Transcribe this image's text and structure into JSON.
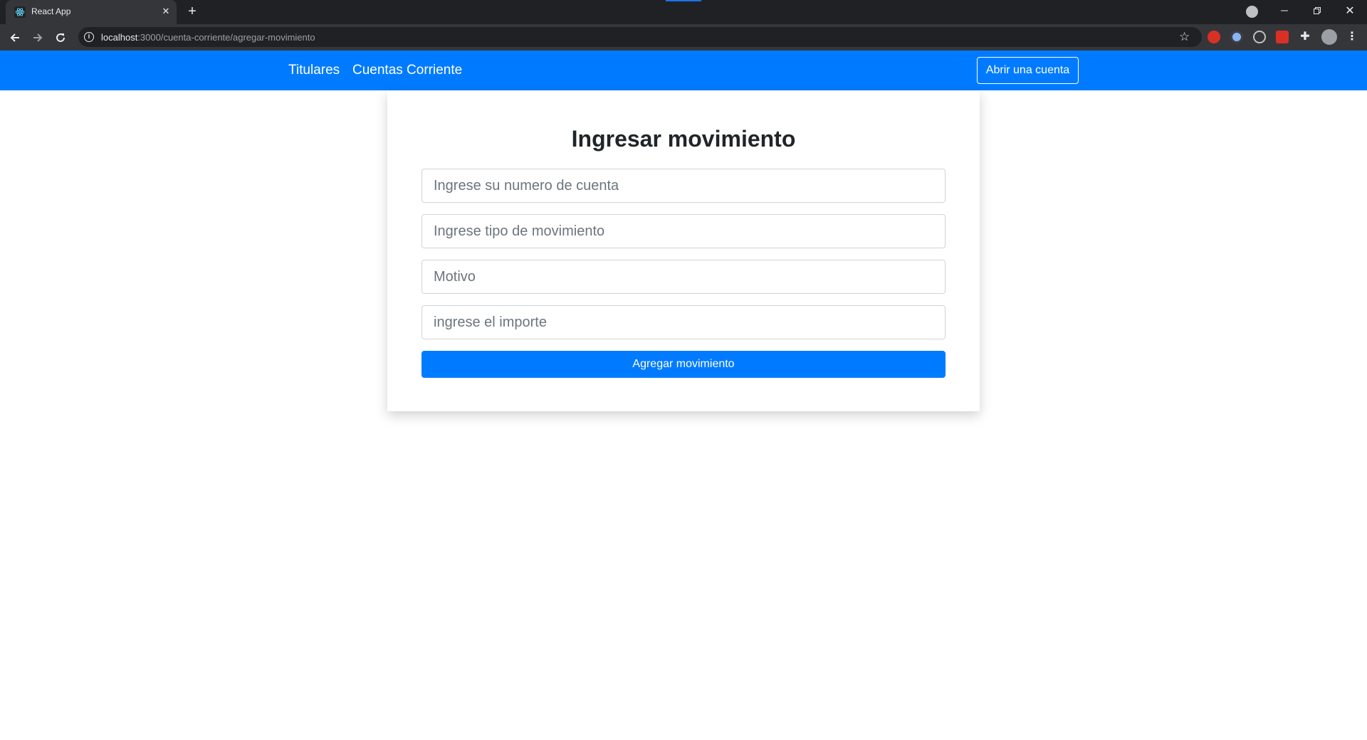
{
  "browser": {
    "tab_title": "React App",
    "url_host": "localhost",
    "url_path": ":3000/cuenta-corriente/agregar-movimiento",
    "icons": [
      "react-favicon",
      "tab-close-icon",
      "new-tab-icon",
      "back-arrow-icon",
      "forward-arrow-icon",
      "reload-icon",
      "site-info-icon",
      "bookmark-star-icon",
      "extensions-puzzle-icon",
      "profile-avatar-icon",
      "more-menu-icon"
    ]
  },
  "navbar": {
    "links": [
      "Titulares",
      "Cuentas Corriente"
    ],
    "action_label": "Abrir una cuenta",
    "color": "#007bff"
  },
  "form": {
    "title": "Ingresar movimiento",
    "fields": [
      {
        "placeholder": "Ingrese su numero de cuenta",
        "value": ""
      },
      {
        "placeholder": "Ingrese tipo de movimiento",
        "value": ""
      },
      {
        "placeholder": "Motivo",
        "value": ""
      },
      {
        "placeholder": "ingrese el importe",
        "value": ""
      }
    ],
    "submit_label": "Agregar movimiento"
  }
}
